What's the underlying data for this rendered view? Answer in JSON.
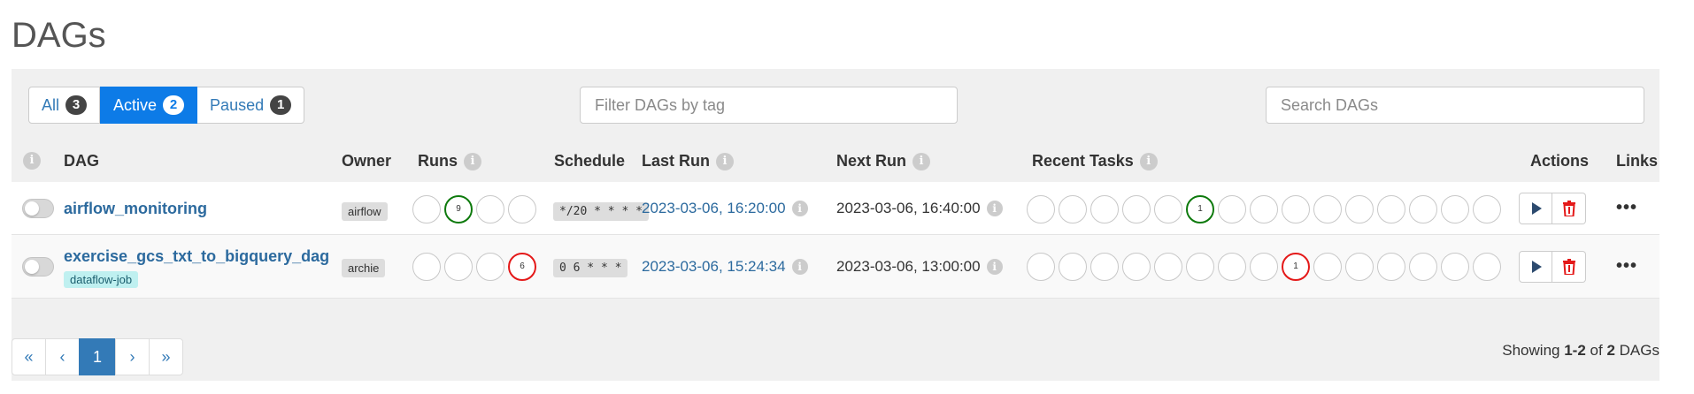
{
  "page": {
    "title": "DAGs"
  },
  "status_filters": [
    {
      "label": "All",
      "count": "3",
      "active": false
    },
    {
      "label": "Active",
      "count": "2",
      "active": true
    },
    {
      "label": "Paused",
      "count": "1",
      "active": false
    }
  ],
  "tag_filter": {
    "placeholder": "Filter DAGs by tag",
    "value": ""
  },
  "search": {
    "placeholder": "Search DAGs",
    "value": ""
  },
  "columns": {
    "dag": "DAG",
    "owner": "Owner",
    "runs": "Runs",
    "schedule": "Schedule",
    "last_run": "Last Run",
    "next_run": "Next Run",
    "recent_tasks": "Recent Tasks",
    "actions": "Actions",
    "links": "Links"
  },
  "info_glyph": "i",
  "dags": [
    {
      "dag_id": "airflow_monitoring",
      "tags": [],
      "paused": true,
      "owner": "airflow",
      "runs": [
        "",
        "9",
        "",
        ""
      ],
      "schedule": "*/20 * * * *",
      "last_run": "2023-03-06, 16:20:00",
      "next_run": "2023-03-06, 16:40:00",
      "recent_tasks": [
        "",
        "",
        "",
        "",
        "",
        "1",
        "",
        "",
        "",
        "",
        "",
        "",
        "",
        "",
        ""
      ],
      "more_glyph": "•••"
    },
    {
      "dag_id": "exercise_gcs_txt_to_bigquery_dag",
      "tags": [
        "dataflow-job"
      ],
      "paused": true,
      "owner": "archie",
      "runs": [
        "",
        "",
        "",
        "6"
      ],
      "schedule": "0 6 * * *",
      "last_run": "2023-03-06, 15:24:34",
      "next_run": "2023-03-06, 13:00:00",
      "recent_tasks": [
        "",
        "",
        "",
        "",
        "",
        "",
        "",
        "",
        "1",
        "",
        "",
        "",
        "",
        "",
        ""
      ],
      "more_glyph": "•••"
    }
  ],
  "status_colors": {
    "success": "#0e7a0d",
    "failed": "#e41919",
    "accent": "#0d7be7"
  },
  "pagination": {
    "first": "«",
    "prev": "‹",
    "current": "1",
    "next": "›",
    "last": "»"
  },
  "showing": {
    "prefix": "Showing",
    "range": "1-2",
    "of": "of",
    "total": "2",
    "suffix": "DAGs"
  }
}
